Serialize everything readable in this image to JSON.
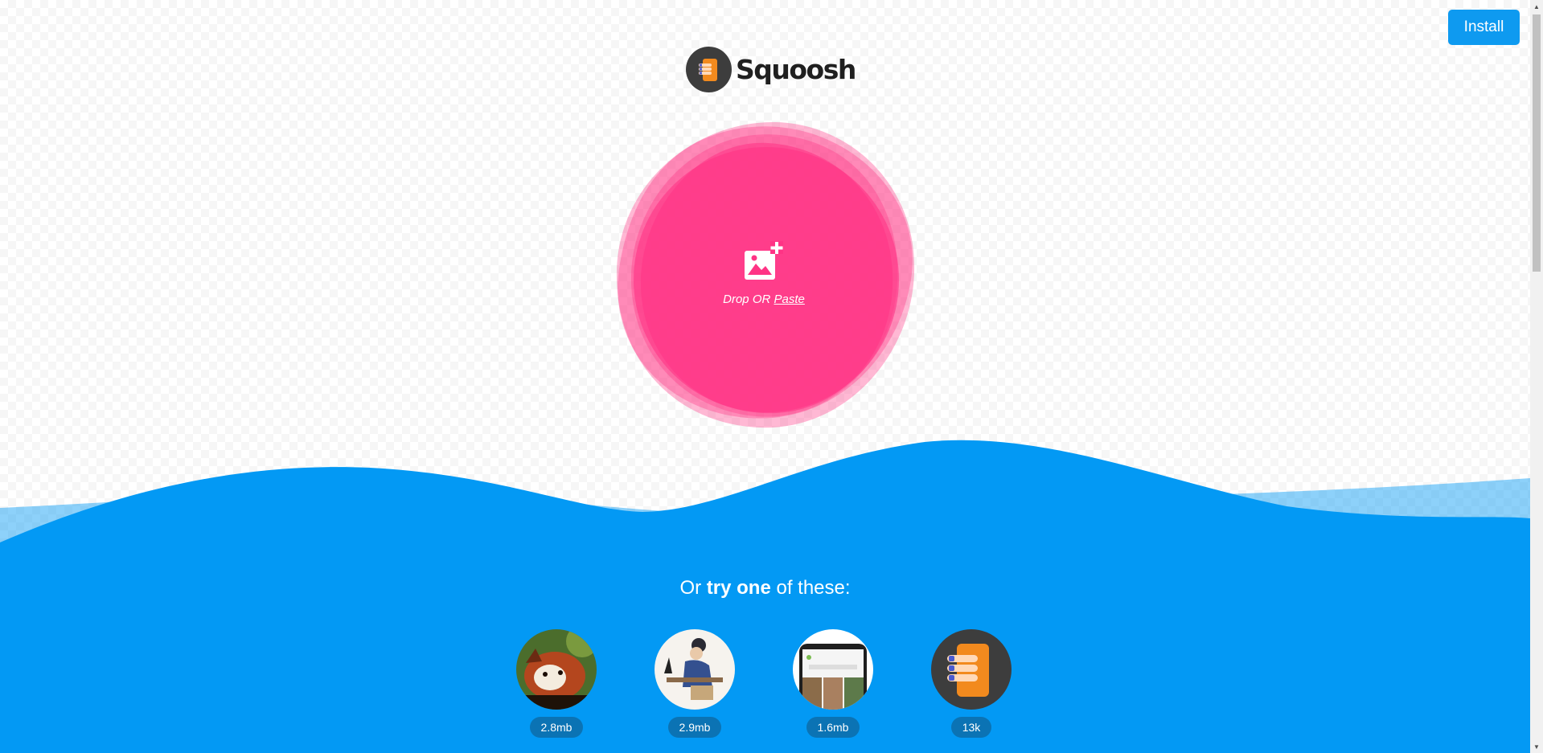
{
  "header": {
    "install_label": "Install"
  },
  "logo": {
    "text": "Squoosh"
  },
  "drop": {
    "prefix": "Drop OR ",
    "paste_label": "Paste"
  },
  "try": {
    "prefix": "Or ",
    "bold": "try one",
    "suffix": " of these:"
  },
  "demos": [
    {
      "size": "2.8mb",
      "icon": "red-panda-photo"
    },
    {
      "size": "2.9mb",
      "icon": "illustration-artwork"
    },
    {
      "size": "1.6mb",
      "icon": "device-screenshot"
    },
    {
      "size": "13k",
      "icon": "squoosh-logo-icon"
    }
  ],
  "colors": {
    "accent": "#0e9af0",
    "wave": "#0399f4",
    "blob": "#ff3385"
  }
}
